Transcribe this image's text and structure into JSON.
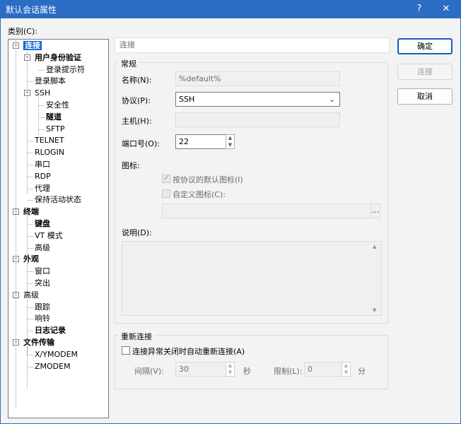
{
  "window": {
    "title": "默认会话属性",
    "help_label": "?",
    "close_label": "✕"
  },
  "category_label": "类别(C):",
  "tree": {
    "items": [
      {
        "label": "连接",
        "bold": true,
        "selected": true
      },
      {
        "label": "用户身份验证",
        "bold": true
      },
      {
        "label": "登录提示符"
      },
      {
        "label": "登录脚本"
      },
      {
        "label": "SSH"
      },
      {
        "label": "安全性"
      },
      {
        "label": "隧道",
        "bold": true
      },
      {
        "label": "SFTP"
      },
      {
        "label": "TELNET"
      },
      {
        "label": "RLOGIN"
      },
      {
        "label": "串口"
      },
      {
        "label": "RDP"
      },
      {
        "label": "代理"
      },
      {
        "label": "保持活动状态"
      },
      {
        "label": "终端",
        "bold": true
      },
      {
        "label": "键盘",
        "bold": true
      },
      {
        "label": "VT 模式"
      },
      {
        "label": "高级"
      },
      {
        "label": "外观",
        "bold": true
      },
      {
        "label": "窗口"
      },
      {
        "label": "突出"
      },
      {
        "label": "高级"
      },
      {
        "label": "跟踪"
      },
      {
        "label": "响铃"
      },
      {
        "label": "日志记录",
        "bold": true
      },
      {
        "label": "文件传输",
        "bold": true
      },
      {
        "label": "X/YMODEM"
      },
      {
        "label": "ZMODEM"
      }
    ]
  },
  "section_header": "连接",
  "general": {
    "title": "常规",
    "name_label": "名称(N):",
    "name_value": "%default%",
    "protocol_label": "协议(P):",
    "protocol_value": "SSH",
    "host_label": "主机(H):",
    "host_value": "",
    "port_label": "端口号(O):",
    "port_value": "22",
    "icon_label": "图标:",
    "use_protocol_icon_label": "按协议的默认图标(I)",
    "custom_icon_label": "自定义图标(C):",
    "browse_label": "...",
    "desc_label": "说明(D):"
  },
  "reconnect": {
    "title": "重新连接",
    "auto_reconnect_label": "连接异常关闭时自动重新连接(A)",
    "interval_label": "间隔(V):",
    "interval_value": "30",
    "interval_unit": "秒",
    "limit_label": "限制(L):",
    "limit_value": "0",
    "limit_unit": "分"
  },
  "buttons": {
    "ok": "确定",
    "connect": "连接",
    "cancel": "取消"
  }
}
